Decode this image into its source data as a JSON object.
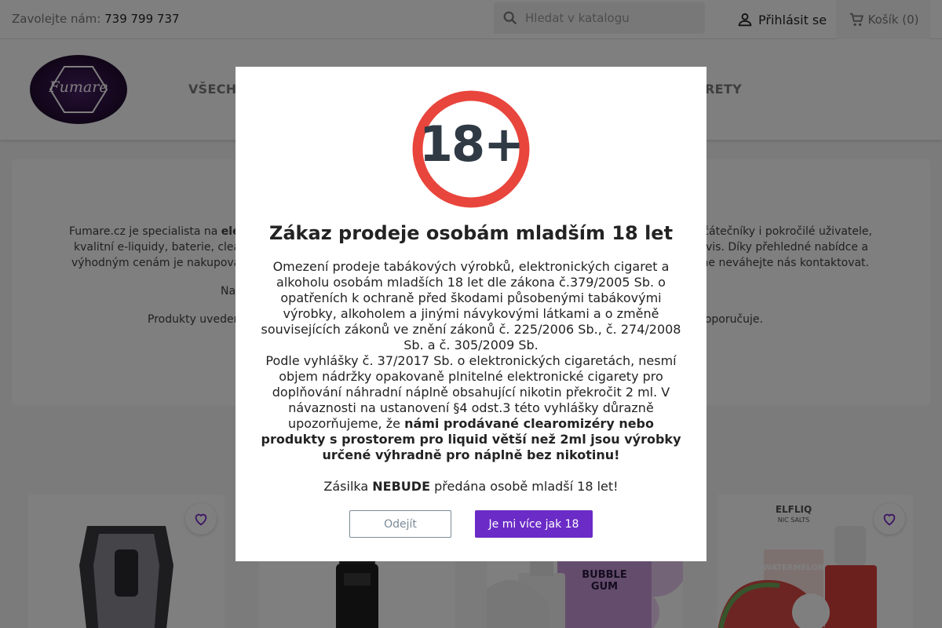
{
  "topbar": {
    "phone_label": "Zavolejte nám:",
    "phone_number": "739 799 737",
    "search_placeholder": "Hledat v katalogu",
    "login_label": "Přihlásit se",
    "cart_label": "Košík (0)"
  },
  "header": {
    "logo_text": "Fumare",
    "nav": [
      {
        "label": "VŠECHN"
      },
      {
        "label": "RETY"
      }
    ]
  },
  "intro": {
    "lines": [
      {
        "prefix": "Fumare.cz je specialista na ",
        "bold": "elek",
        "suffix": ""
      },
      {
        "text": "kvalitní e-liquidy, baterie, clearo"
      },
      {
        "text": "výhodným cenám je nakupování"
      },
      {
        "text": "začátečníky i pokročilé uživatele,"
      },
      {
        "text": "servis. Díky přehledné nabídce a"
      },
      {
        "text": "prosíme neváhejte nás kontaktovat."
      },
      {
        "text": "Na"
      },
      {
        "text": "oží."
      },
      {
        "text": "Produkty uveden"
      },
      {
        "text": "se nedoporučuje."
      }
    ]
  },
  "products": [
    {
      "name": "pod-cartridge"
    },
    {
      "name": "vape-tank"
    },
    {
      "name": "bubble-gum-liquid",
      "label": "BUBBLE GUM"
    },
    {
      "name": "elfliq-watermelon",
      "brand": "ELFLIQ",
      "sub": "NIC SALTS",
      "flavor": "WATERMELON"
    }
  ],
  "modal": {
    "badge_text": "18+",
    "title": "Zákaz prodeje osobám mladším 18 let",
    "para1": "Omezení prodeje tabákových výrobků, elektronických cigaret a alkoholu osobám mladších 18 let dle zákona č.379/2005 Sb. o opatřeních k ochraně před škodami působenými tabákovými výrobky, alkoholem a jinými návykovými látkami a o změně souvisejících zákonů ve znění zákonů č. 225/2006 Sb., č. 274/2008 Sb. a č. 305/2009 Sb.",
    "para2_normal": "Podle vyhlášky č. 37/2017 Sb. o elektronických cigaretách, nesmí objem nádržky opakovaně plnitelné elektronické cigarety pro doplňování náhradní náplně obsahující nikotin překročit 2 ml. V návaznosti na ustanovení §4 odst.3 této vyhlášky důrazně upozorňujeme, že ",
    "para2_bold": "námi prodávané clearomizéry nebo produkty s prostorem pro liquid větší než 2ml jsou výrobky určené výhradně pro náplně bez nikotinu!",
    "para3_a": "Zásilka ",
    "para3_bold": "NEBUDE",
    "para3_b": " předána osobě mladší 18 let!",
    "leave_label": "Odejít",
    "confirm_label": "Je mi více jak 18"
  },
  "colors": {
    "accent": "#6a2bc7",
    "badge_ring": "#e8453c"
  }
}
